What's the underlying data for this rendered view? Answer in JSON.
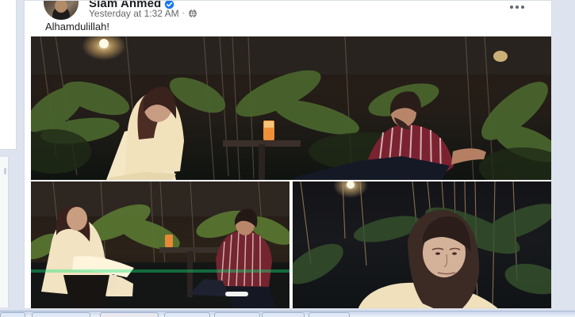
{
  "post": {
    "author": "Siam Ahmed",
    "timestamp": "Yesterday at 1:32 AM",
    "separator": "·",
    "text": "Alhamdulillah!",
    "icons": {
      "verified": "verified-badge-icon",
      "audience": "globe-icon",
      "menu": "more-options-icon"
    }
  },
  "photos": {
    "count": 3,
    "descriptions": []
  },
  "colors": {
    "background": "#dde3ef",
    "card": "#ffffff",
    "text": "#1c1e21",
    "muted": "#65676b",
    "verified": "#1877f2"
  }
}
